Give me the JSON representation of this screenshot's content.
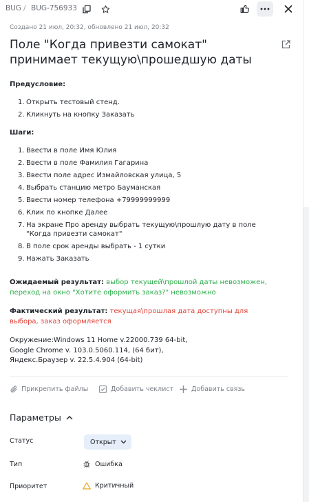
{
  "breadcrumb": {
    "queue": "BUG",
    "separator": "/",
    "key": "BUG-756933"
  },
  "icons": {
    "copy": "copy-icon",
    "star": "star-icon",
    "like": "thumbs-up-icon",
    "more": "more-icon",
    "close": "close-icon",
    "external": "external-link-icon",
    "attach": "paperclip-icon",
    "checklist": "checkbox-icon",
    "link": "plus-icon",
    "bug": "bug-icon",
    "priority": "warning-triangle-icon"
  },
  "issue": {
    "meta": "Создано 21 июл, 20:32, обновлено 21 июл, 20:32",
    "title": "Поле \"Когда привезти самокат\" принимает текущую\\прошедшую даты",
    "precondition_label": "Предусловие:",
    "preconditions": [
      {
        "n": "1.",
        "text": "Открыть тестовый стенд."
      },
      {
        "n": "2.",
        "text": "Кликнуть на кнопку Заказать"
      }
    ],
    "steps_label": "Шаги:",
    "steps": [
      {
        "n": "1.",
        "text": "Ввести в поле Имя Юлия"
      },
      {
        "n": "2.",
        "text": "Ввести в поле Фамилия Гагарина"
      },
      {
        "n": "3.",
        "text": "Ввести поле адрес Измайловская улица, 5"
      },
      {
        "n": "4.",
        "text": "Выбрать станцию метро Бауманская"
      },
      {
        "n": "5.",
        "text": "Ввести номер телефона +79999999999"
      },
      {
        "n": "6.",
        "text": "Клик по кнопке Далее"
      },
      {
        "n": "7.",
        "text": "На экране Про аренду выбрать текущую\\прошлую дату в поле \"Когда привезти самокат\""
      },
      {
        "n": "8.",
        "text": "В поле срок аренды выбрать - 1 сутки"
      },
      {
        "n": "9.",
        "text": "Нажать Заказать"
      }
    ],
    "expected_label": "Ожидаемый результат:",
    "expected_text": "выбор текущей\\прошлой даты невозможен, переход на окно \"Хотите оформить заказ?\" невозможно",
    "actual_label": "Фактический результат:",
    "actual_text": "текущая\\прошлая дата доступны для выбора, заказ оформляется",
    "environment": [
      "Окружение:Windows 11 Home v.22000.739 64-bit,",
      "Google Chrome v. 103.0.5060.114, (64 бит),",
      "Яндекс.Браузер v. 22.5.4.904 (64-bit)"
    ]
  },
  "actions": {
    "attach": "Прикрепить файлы",
    "checklist": "Добавить чеклист",
    "link": "Добавить связь"
  },
  "params": {
    "title": "Параметры",
    "status_label": "Статус",
    "status_value": "Открыт",
    "type_label": "Тип",
    "type_value": "Ошибка",
    "priority_label": "Приоритет",
    "priority_value": "Критичный"
  },
  "colors": {
    "expected": "#2fae4c",
    "actual": "#e0443a",
    "status_pill": "#e6eef9",
    "priority": "#e8a320"
  }
}
